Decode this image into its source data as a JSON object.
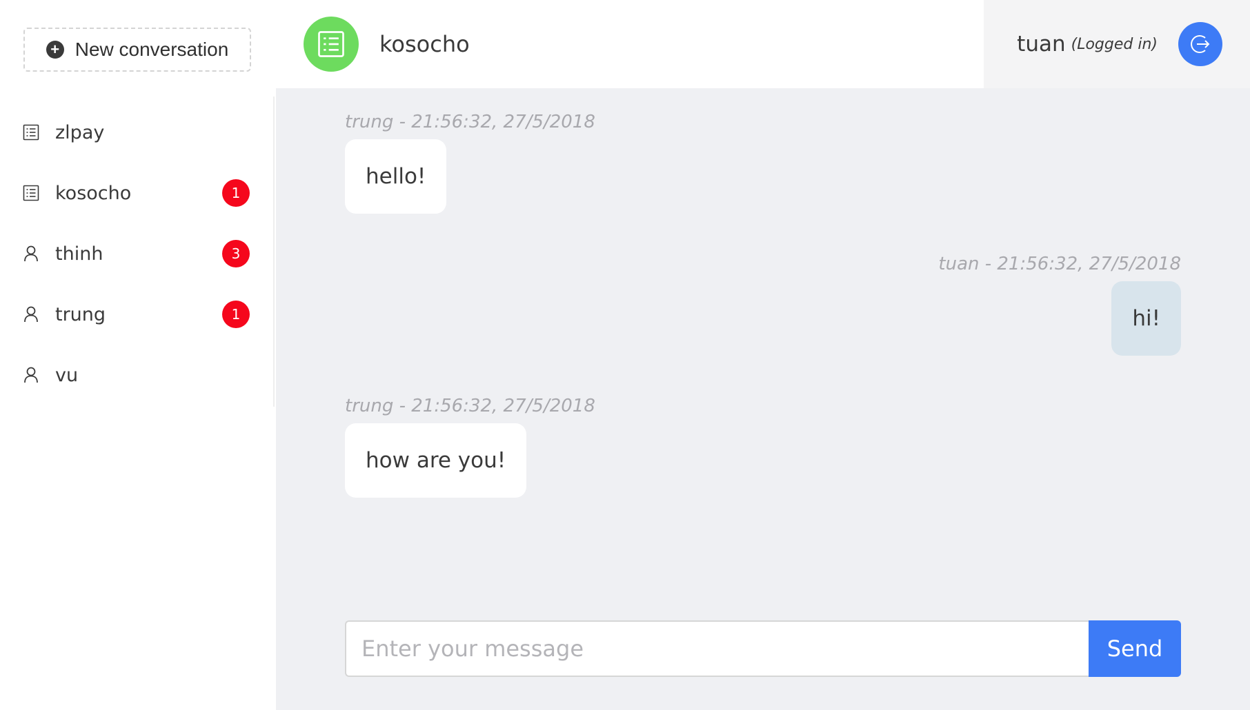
{
  "sidebar": {
    "new_conversation_label": "New conversation",
    "items": [
      {
        "label": "zlpay",
        "icon": "list-icon",
        "badge": ""
      },
      {
        "label": "kosocho",
        "icon": "list-icon",
        "badge": "1"
      },
      {
        "label": "thinh",
        "icon": "user-icon",
        "badge": "3"
      },
      {
        "label": "trung",
        "icon": "user-icon",
        "badge": "1"
      },
      {
        "label": "vu",
        "icon": "user-icon",
        "badge": ""
      }
    ]
  },
  "header": {
    "title": "kosocho",
    "avatar_icon": "list-icon",
    "avatar_color": "#6ddb5e"
  },
  "user": {
    "name": "tuan",
    "status": "(Logged in)",
    "logout_icon": "logout-icon"
  },
  "messages": [
    {
      "meta": "trung - 21:56:32, 27/5/2018",
      "text": "hello!",
      "side": "left"
    },
    {
      "meta": "tuan - 21:56:32, 27/5/2018",
      "text": "hi!",
      "side": "right"
    },
    {
      "meta": "trung - 21:56:32, 27/5/2018",
      "text": "how are you!",
      "side": "left"
    }
  ],
  "composer": {
    "placeholder": "Enter your message",
    "value": "",
    "send_label": "Send"
  },
  "colors": {
    "accent": "#3d7bf6",
    "badge": "#f5071c",
    "chat_background": "#eff0f3",
    "my_bubble": "#d8e4ec"
  }
}
